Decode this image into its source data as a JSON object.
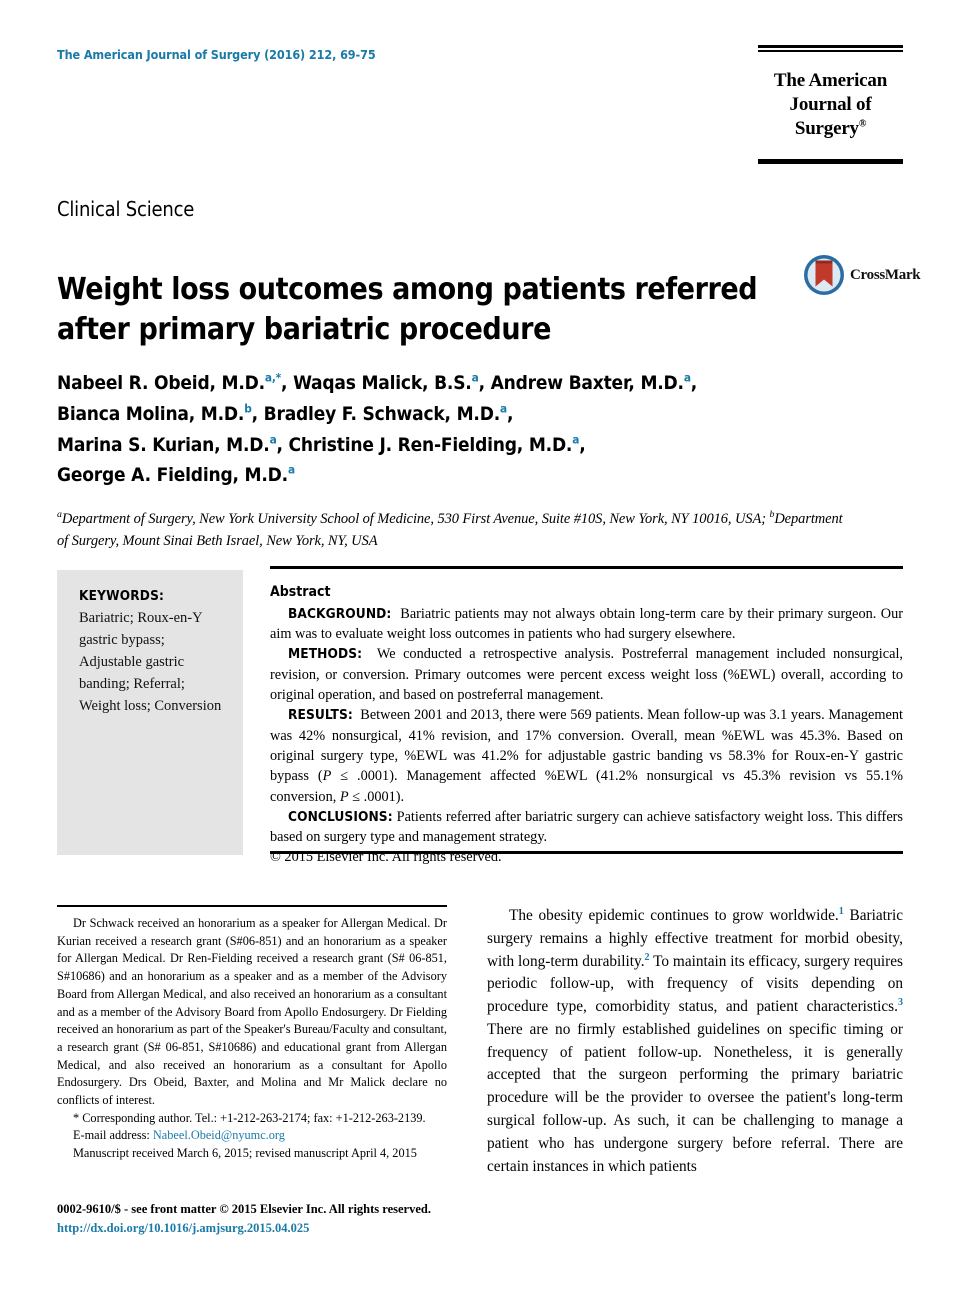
{
  "colors": {
    "accent_blue": "#1a7aa8",
    "keywords_box_bg": "#e4e4e4",
    "rule_black": "#000000"
  },
  "running_head": "The American Journal of Surgery (2016) 212, 69-75",
  "masthead": {
    "line1": "The American",
    "line2": "Journal of Surgery",
    "registered_mark": "®"
  },
  "section_label": "Clinical Science",
  "title": "Weight loss outcomes among patients referred after primary bariatric procedure",
  "crossmark": {
    "label": "CrossMark",
    "icon": "crossmark-icon"
  },
  "authors": {
    "line1_a": "Nabeel R. Obeid, M.D.",
    "line1_a_sup": "a,*",
    "line1_b": ", Waqas Malick, B.S.",
    "line1_b_sup": "a",
    "line1_c": ", Andrew Baxter, M.D.",
    "line1_c_sup": "a",
    "line1_d": ",",
    "line2_a": "Bianca Molina, M.D.",
    "line2_a_sup": "b",
    "line2_b": ", Bradley F. Schwack, M.D.",
    "line2_b_sup": "a",
    "line2_c": ",",
    "line3_a": "Marina S. Kurian, M.D.",
    "line3_a_sup": "a",
    "line3_b": ", Christine J. Ren-Fielding, M.D.",
    "line3_b_sup": "a",
    "line3_c": ",",
    "line4_a": "George A. Fielding, M.D.",
    "line4_a_sup": "a"
  },
  "affiliations": {
    "sup_a": "a",
    "text_a": "Department of Surgery, New York University School of Medicine, 530 First Avenue, Suite #10S, New York, NY 10016, USA; ",
    "sup_b": "b",
    "text_b": "Department of Surgery, Mount Sinai Beth Israel, New York, NY, USA"
  },
  "keywords": {
    "title": "KEYWORDS:",
    "items": "Bariatric; Roux-en-Y gastric bypass; Adjustable gastric banding; Referral; Weight loss; Conversion"
  },
  "abstract": {
    "heading": "Abstract",
    "background_label": "BACKGROUND:",
    "background_text": "Bariatric patients may not always obtain long-term care by their primary surgeon. Our aim was to evaluate weight loss outcomes in patients who had surgery elsewhere.",
    "methods_label": "METHODS:",
    "methods_text": "We conducted a retrospective analysis. Postreferral management included nonsurgical, revision, or conversion. Primary outcomes were percent excess weight loss (%EWL) overall, according to original operation, and based on postreferral management.",
    "results_label": "RESULTS:",
    "results_text_1": "Between 2001 and 2013, there were 569 patients. Mean follow-up was 3.1 years. Management was 42% nonsurgical, 41% revision, and 17% conversion. Overall, mean %EWL was 45.3%. Based on original surgery type, %EWL was 41.2% for adjustable gastric banding vs 58.3% for Roux-en-Y gastric bypass (",
    "results_italic_1": "P",
    "results_text_2": " ≤ .0001). Management affected %EWL (41.2% nonsurgical vs 45.3% revision vs 55.1% conversion, ",
    "results_italic_2": "P",
    "results_text_3": " ≤ .0001).",
    "conclusions_label": "CONCLUSIONS:",
    "conclusions_text": "Patients referred after bariatric surgery can achieve satisfactory weight loss. This differs based on surgery type and management strategy.",
    "copyright": "© 2015 Elsevier Inc. All rights reserved."
  },
  "disclosure": {
    "paragraph": "Dr Schwack received an honorarium as a speaker for Allergan Medical. Dr Kurian received a research grant (S#06-851) and an honorarium as a speaker for Allergan Medical. Dr Ren-Fielding received a research grant (S# 06-851, S#10686) and an honorarium as a speaker and as a member of the Advisory Board from Allergan Medical, and also received an honorarium as a consultant and as a member of the Advisory Board from Apollo Endosurgery. Dr Fielding received an honorarium as part of the Speaker's Bureau/Faculty and consultant, a research grant (S# 06-851, S#10686) and educational grant from Allergan Medical, and also received an honorarium as a consultant for Apollo Endosurgery. Drs Obeid, Baxter, and Molina and Mr Malick declare no conflicts of interest.",
    "corresponding": "* Corresponding author. Tel.: +1-212-263-2174; fax: +1-212-263-2139.",
    "email_label": "E-mail address:",
    "email": "Nabeel.Obeid@nyumc.org",
    "manuscript_dates": "Manuscript received March 6, 2015; revised manuscript April 4, 2015"
  },
  "body": {
    "paragraph_1_a": "The obesity epidemic continues to grow worldwide.",
    "sup_1": "1",
    "paragraph_1_b": " Bariatric surgery remains a highly effective treatment for morbid obesity, with long-term durability.",
    "sup_2": "2",
    "paragraph_1_c": " To maintain its efficacy, surgery requires periodic follow-up, with frequency of visits depending on procedure type, comorbidity status, and patient characteristics.",
    "sup_3": "3",
    "paragraph_1_d": " There are no firmly established guidelines on specific timing or frequency of patient follow-up. Nonetheless, it is generally accepted that the surgeon performing the primary bariatric procedure will be the provider to oversee the patient's long-term surgical follow-up. As such, it can be challenging to manage a patient who has undergone surgery before referral. There are certain instances in which patients"
  },
  "footer": {
    "issn_line": "0002-9610/$ - see front matter © 2015 Elsevier Inc. All rights reserved.",
    "doi": "http://dx.doi.org/10.1016/j.amjsurg.2015.04.025"
  }
}
